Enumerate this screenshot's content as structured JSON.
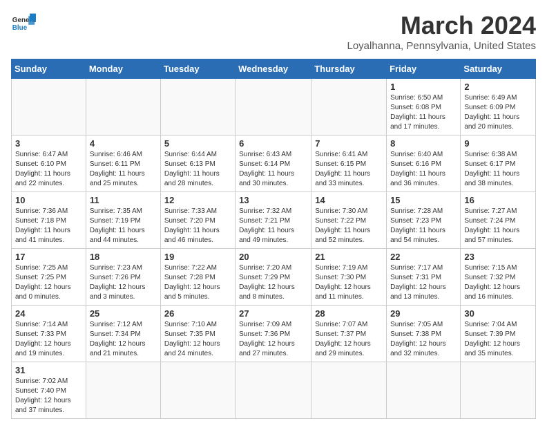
{
  "header": {
    "logo_line1": "General",
    "logo_line2": "Blue",
    "month_year": "March 2024",
    "location": "Loyalhanna, Pennsylvania, United States"
  },
  "columns": [
    "Sunday",
    "Monday",
    "Tuesday",
    "Wednesday",
    "Thursday",
    "Friday",
    "Saturday"
  ],
  "weeks": [
    [
      {
        "day": "",
        "info": ""
      },
      {
        "day": "",
        "info": ""
      },
      {
        "day": "",
        "info": ""
      },
      {
        "day": "",
        "info": ""
      },
      {
        "day": "",
        "info": ""
      },
      {
        "day": "1",
        "info": "Sunrise: 6:50 AM\nSunset: 6:08 PM\nDaylight: 11 hours\nand 17 minutes."
      },
      {
        "day": "2",
        "info": "Sunrise: 6:49 AM\nSunset: 6:09 PM\nDaylight: 11 hours\nand 20 minutes."
      }
    ],
    [
      {
        "day": "3",
        "info": "Sunrise: 6:47 AM\nSunset: 6:10 PM\nDaylight: 11 hours\nand 22 minutes."
      },
      {
        "day": "4",
        "info": "Sunrise: 6:46 AM\nSunset: 6:11 PM\nDaylight: 11 hours\nand 25 minutes."
      },
      {
        "day": "5",
        "info": "Sunrise: 6:44 AM\nSunset: 6:13 PM\nDaylight: 11 hours\nand 28 minutes."
      },
      {
        "day": "6",
        "info": "Sunrise: 6:43 AM\nSunset: 6:14 PM\nDaylight: 11 hours\nand 30 minutes."
      },
      {
        "day": "7",
        "info": "Sunrise: 6:41 AM\nSunset: 6:15 PM\nDaylight: 11 hours\nand 33 minutes."
      },
      {
        "day": "8",
        "info": "Sunrise: 6:40 AM\nSunset: 6:16 PM\nDaylight: 11 hours\nand 36 minutes."
      },
      {
        "day": "9",
        "info": "Sunrise: 6:38 AM\nSunset: 6:17 PM\nDaylight: 11 hours\nand 38 minutes."
      }
    ],
    [
      {
        "day": "10",
        "info": "Sunrise: 7:36 AM\nSunset: 7:18 PM\nDaylight: 11 hours\nand 41 minutes."
      },
      {
        "day": "11",
        "info": "Sunrise: 7:35 AM\nSunset: 7:19 PM\nDaylight: 11 hours\nand 44 minutes."
      },
      {
        "day": "12",
        "info": "Sunrise: 7:33 AM\nSunset: 7:20 PM\nDaylight: 11 hours\nand 46 minutes."
      },
      {
        "day": "13",
        "info": "Sunrise: 7:32 AM\nSunset: 7:21 PM\nDaylight: 11 hours\nand 49 minutes."
      },
      {
        "day": "14",
        "info": "Sunrise: 7:30 AM\nSunset: 7:22 PM\nDaylight: 11 hours\nand 52 minutes."
      },
      {
        "day": "15",
        "info": "Sunrise: 7:28 AM\nSunset: 7:23 PM\nDaylight: 11 hours\nand 54 minutes."
      },
      {
        "day": "16",
        "info": "Sunrise: 7:27 AM\nSunset: 7:24 PM\nDaylight: 11 hours\nand 57 minutes."
      }
    ],
    [
      {
        "day": "17",
        "info": "Sunrise: 7:25 AM\nSunset: 7:25 PM\nDaylight: 12 hours\nand 0 minutes."
      },
      {
        "day": "18",
        "info": "Sunrise: 7:23 AM\nSunset: 7:26 PM\nDaylight: 12 hours\nand 3 minutes."
      },
      {
        "day": "19",
        "info": "Sunrise: 7:22 AM\nSunset: 7:28 PM\nDaylight: 12 hours\nand 5 minutes."
      },
      {
        "day": "20",
        "info": "Sunrise: 7:20 AM\nSunset: 7:29 PM\nDaylight: 12 hours\nand 8 minutes."
      },
      {
        "day": "21",
        "info": "Sunrise: 7:19 AM\nSunset: 7:30 PM\nDaylight: 12 hours\nand 11 minutes."
      },
      {
        "day": "22",
        "info": "Sunrise: 7:17 AM\nSunset: 7:31 PM\nDaylight: 12 hours\nand 13 minutes."
      },
      {
        "day": "23",
        "info": "Sunrise: 7:15 AM\nSunset: 7:32 PM\nDaylight: 12 hours\nand 16 minutes."
      }
    ],
    [
      {
        "day": "24",
        "info": "Sunrise: 7:14 AM\nSunset: 7:33 PM\nDaylight: 12 hours\nand 19 minutes."
      },
      {
        "day": "25",
        "info": "Sunrise: 7:12 AM\nSunset: 7:34 PM\nDaylight: 12 hours\nand 21 minutes."
      },
      {
        "day": "26",
        "info": "Sunrise: 7:10 AM\nSunset: 7:35 PM\nDaylight: 12 hours\nand 24 minutes."
      },
      {
        "day": "27",
        "info": "Sunrise: 7:09 AM\nSunset: 7:36 PM\nDaylight: 12 hours\nand 27 minutes."
      },
      {
        "day": "28",
        "info": "Sunrise: 7:07 AM\nSunset: 7:37 PM\nDaylight: 12 hours\nand 29 minutes."
      },
      {
        "day": "29",
        "info": "Sunrise: 7:05 AM\nSunset: 7:38 PM\nDaylight: 12 hours\nand 32 minutes."
      },
      {
        "day": "30",
        "info": "Sunrise: 7:04 AM\nSunset: 7:39 PM\nDaylight: 12 hours\nand 35 minutes."
      }
    ],
    [
      {
        "day": "31",
        "info": "Sunrise: 7:02 AM\nSunset: 7:40 PM\nDaylight: 12 hours\nand 37 minutes."
      },
      {
        "day": "",
        "info": ""
      },
      {
        "day": "",
        "info": ""
      },
      {
        "day": "",
        "info": ""
      },
      {
        "day": "",
        "info": ""
      },
      {
        "day": "",
        "info": ""
      },
      {
        "day": "",
        "info": ""
      }
    ]
  ]
}
